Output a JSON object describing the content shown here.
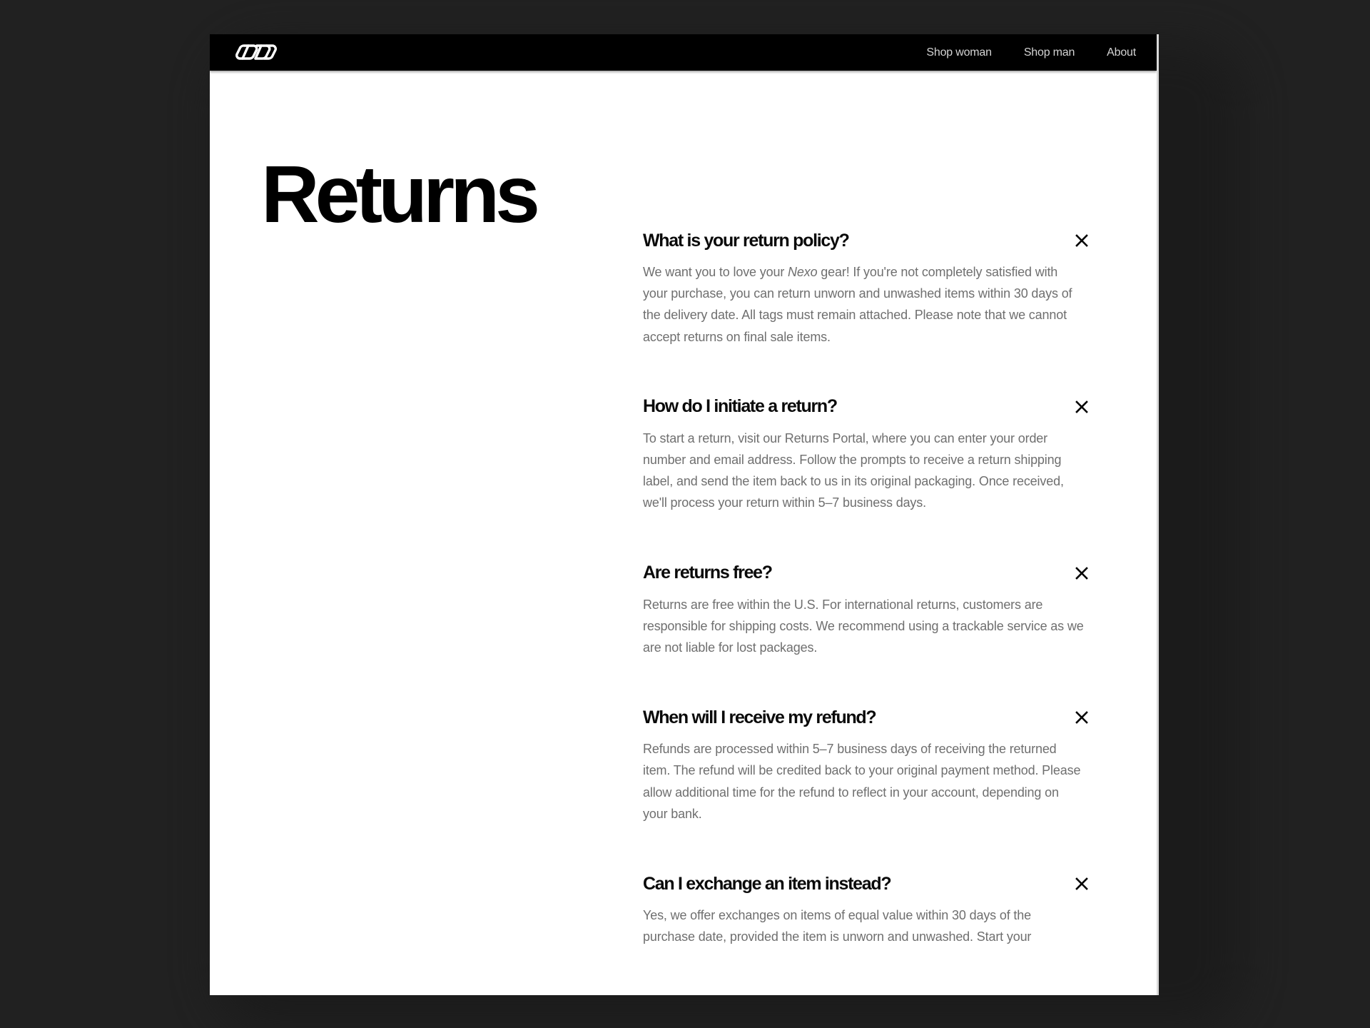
{
  "header": {
    "logo_icon": "chain-links-logo-icon",
    "nav": [
      {
        "label": "Shop woman"
      },
      {
        "label": "Shop man"
      },
      {
        "label": "About"
      }
    ]
  },
  "page": {
    "title": "Returns"
  },
  "faq": [
    {
      "question": "What is your return policy?",
      "answer_before": "We want you to love your ",
      "answer_em": "Nexo",
      "answer_after": " gear! If you're not completely satisfied with your purchase, you can return unworn and unwashed items within 30 days of the delivery date. All tags must remain attached. Please note that we cannot accept returns on final sale items.",
      "icon": "close-icon"
    },
    {
      "question": "How do I initiate a return?",
      "answer": "To start a return, visit our Returns Portal, where you can enter your order number and email address. Follow the prompts to receive a return shipping label, and send the item back to us in its original packaging. Once received, we'll process your return within 5–7 business days.",
      "icon": "close-icon"
    },
    {
      "question": "Are returns free?",
      "answer": "Returns are free within the U.S. For international returns, customers are responsible for shipping costs. We recommend using a trackable service as we are not liable for lost packages.",
      "icon": "close-icon"
    },
    {
      "question": "When will I receive my refund?",
      "answer": "Refunds are processed within 5–7 business days of receiving the returned item. The refund will be credited back to your original payment method. Please allow additional time for the refund to reflect in your account, depending on your bank.",
      "icon": "close-icon"
    },
    {
      "question": "Can I exchange an item instead?",
      "answer": "Yes, we offer exchanges on items of equal value within 30 days of the purchase date, provided the item is unworn and unwashed. Start your",
      "icon": "close-icon"
    }
  ],
  "colors": {
    "background": "#212121",
    "card": "#ffffff",
    "header": "#000000",
    "nav_text": "#d4d4d4",
    "title_text": "#000000",
    "body_text": "#6f6f6f"
  }
}
